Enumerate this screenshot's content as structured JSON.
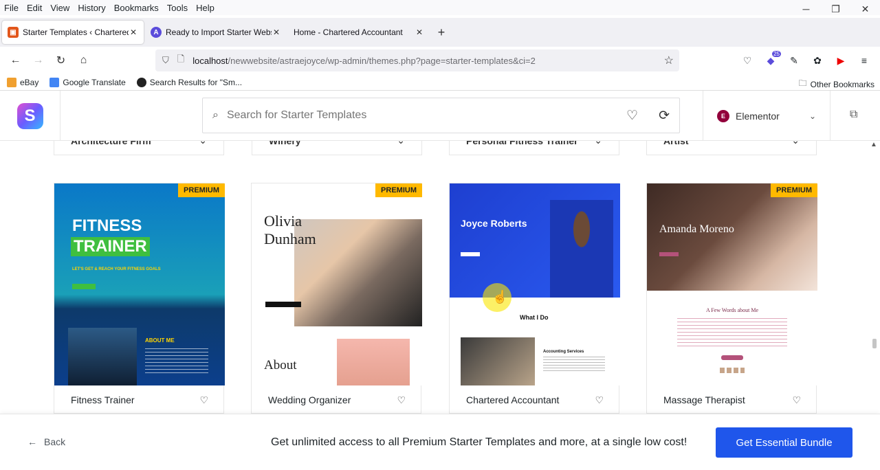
{
  "menubar": {
    "items": [
      "File",
      "Edit",
      "View",
      "History",
      "Bookmarks",
      "Tools",
      "Help"
    ]
  },
  "tabs": [
    {
      "label": "Starter Templates ‹ Chartered Accountant",
      "icon_color": "#e2561b"
    },
    {
      "label": "Ready to Import Starter Website",
      "icon_color": "#5b4cdb"
    },
    {
      "label": "Home - Chartered Accountant",
      "icon_color": ""
    }
  ],
  "url": {
    "host": "localhost",
    "path": "/newwebsite/astraejoyce/wp-admin/themes.php?page=starter-templates&ci=2"
  },
  "extension_badge": "25",
  "bookmarks": {
    "items": [
      "eBay",
      "Google Translate",
      "Search Results for \"Sm..."
    ],
    "other": "Other Bookmarks"
  },
  "search": {
    "placeholder": "Search for Starter Templates"
  },
  "builder": {
    "label": "Elementor"
  },
  "prev_row": [
    "Architecture Firm",
    "Winery",
    "Personal Fitness Trainer",
    "Artist"
  ],
  "cards": [
    {
      "title": "Fitness Trainer",
      "premium": "PREMIUM",
      "hero1": "FITNESS",
      "hero2": "TRAINER",
      "tagline": "LET'S GET & REACH YOUR FITNESS GOALS",
      "section": "ABOUT ME"
    },
    {
      "title": "Wedding Organizer",
      "premium": "PREMIUM",
      "hero1": "Olivia",
      "hero2": "Dunham",
      "section": "About"
    },
    {
      "title": "Chartered Accountant",
      "premium": "",
      "hero1": "Joyce Roberts",
      "section": "What I Do",
      "service": "Accounting Services"
    },
    {
      "title": "Massage Therapist",
      "premium": "PREMIUM",
      "hero1": "Amanda Moreno",
      "section": "A Few Words about Me"
    }
  ],
  "footer": {
    "back": "Back",
    "promo": "Get unlimited access to all Premium Starter Templates and more, at a single low cost!",
    "cta": "Get Essential Bundle"
  }
}
